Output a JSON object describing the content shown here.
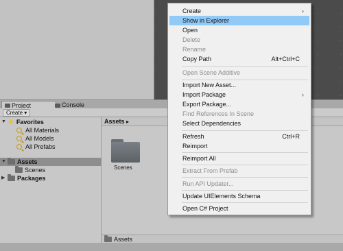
{
  "tabs": [
    {
      "label": "Project",
      "icon": "project-icon"
    },
    {
      "label": "Console",
      "icon": "console-icon"
    }
  ],
  "toolbar": {
    "create_label": "Create",
    "dropdown_glyph": "▾"
  },
  "tree": {
    "favorites": {
      "label": "Favorites",
      "items": [
        "All Materials",
        "All Models",
        "All Prefabs"
      ]
    },
    "assets": {
      "label": "Assets",
      "children": [
        "Scenes"
      ]
    },
    "packages": {
      "label": "Packages"
    }
  },
  "browser": {
    "path": "Assets",
    "path_arrow": "▸",
    "items": [
      {
        "label": "Scenes",
        "icon": "folder-icon"
      }
    ],
    "bottom_path": "Assets"
  },
  "context_menu": {
    "items": [
      {
        "label": "Create",
        "shortcut": "",
        "submenu": true,
        "disabled": false,
        "highlighted": false
      },
      {
        "label": "Show in Explorer",
        "shortcut": "",
        "submenu": false,
        "disabled": false,
        "highlighted": true
      },
      {
        "label": "Open",
        "shortcut": "",
        "submenu": false,
        "disabled": false,
        "highlighted": false
      },
      {
        "label": "Delete",
        "shortcut": "",
        "submenu": false,
        "disabled": true,
        "highlighted": false
      },
      {
        "label": "Rename",
        "shortcut": "",
        "submenu": false,
        "disabled": true,
        "highlighted": false
      },
      {
        "label": "Copy Path",
        "shortcut": "Alt+Ctrl+C",
        "submenu": false,
        "disabled": false,
        "highlighted": false
      },
      {
        "label": "Open Scene Additive",
        "shortcut": "",
        "submenu": false,
        "disabled": true,
        "highlighted": false
      },
      {
        "label": "Import New Asset...",
        "shortcut": "",
        "submenu": false,
        "disabled": false,
        "highlighted": false
      },
      {
        "label": "Import Package",
        "shortcut": "",
        "submenu": true,
        "disabled": false,
        "highlighted": false
      },
      {
        "label": "Export Package...",
        "shortcut": "",
        "submenu": false,
        "disabled": false,
        "highlighted": false
      },
      {
        "label": "Find References In Scene",
        "shortcut": "",
        "submenu": false,
        "disabled": true,
        "highlighted": false
      },
      {
        "label": "Select Dependencies",
        "shortcut": "",
        "submenu": false,
        "disabled": false,
        "highlighted": false
      },
      {
        "label": "Refresh",
        "shortcut": "Ctrl+R",
        "submenu": false,
        "disabled": false,
        "highlighted": false
      },
      {
        "label": "Reimport",
        "shortcut": "",
        "submenu": false,
        "disabled": false,
        "highlighted": false
      },
      {
        "label": "Reimport All",
        "shortcut": "",
        "submenu": false,
        "disabled": false,
        "highlighted": false
      },
      {
        "label": "Extract From Prefab",
        "shortcut": "",
        "submenu": false,
        "disabled": true,
        "highlighted": false
      },
      {
        "label": "Run API Updater...",
        "shortcut": "",
        "submenu": false,
        "disabled": true,
        "highlighted": false
      },
      {
        "label": "Update UIElements Schema",
        "shortcut": "",
        "submenu": false,
        "disabled": false,
        "highlighted": false
      },
      {
        "label": "Open C# Project",
        "shortcut": "",
        "submenu": false,
        "disabled": false,
        "highlighted": false
      }
    ],
    "submenu_glyph": "›"
  },
  "colors": {
    "highlight": "#91c9f7",
    "disabled_text": "#8d8d8d",
    "menu_bg": "#f0f0f0"
  }
}
